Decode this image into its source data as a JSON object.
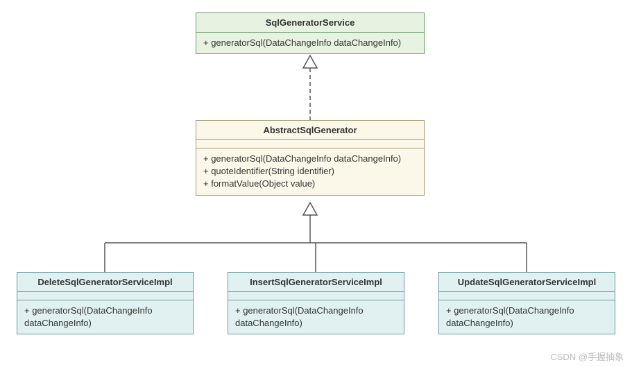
{
  "interface": {
    "name": "SqlGeneratorService",
    "methods": [
      "+ generatorSql(DataChangeInfo dataChangeInfo)"
    ]
  },
  "abstract": {
    "name": "AbstractSqlGenerator",
    "methods": [
      "+ generatorSql(DataChangeInfo dataChangeInfo)",
      "+ quoteIdentifier(String identifier)",
      "+ formatValue(Object value)"
    ]
  },
  "impls": {
    "delete": {
      "name": "DeleteSqlGeneratorServiceImpl",
      "method1": "+ generatorSql(DataChangeInfo",
      "method2": "dataChangeInfo)"
    },
    "insert": {
      "name": "InsertSqlGeneratorServiceImpl",
      "method1": "+ generatorSql(DataChangeInfo",
      "method2": "dataChangeInfo)"
    },
    "update": {
      "name": "UpdateSqlGeneratorServiceImpl",
      "method1": "+ generatorSql(DataChangeInfo",
      "method2": "dataChangeInfo)"
    }
  },
  "watermark": "CSDN @手握抽象"
}
